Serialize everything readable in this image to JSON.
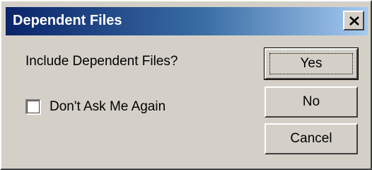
{
  "dialog": {
    "title": "Dependent Files",
    "close_icon": "close-icon",
    "prompt": "Include Dependent Files?",
    "checkbox_label": "Don't Ask Me Again",
    "checkbox_checked": false,
    "buttons": {
      "yes": "Yes",
      "no": "No",
      "cancel": "Cancel"
    }
  }
}
